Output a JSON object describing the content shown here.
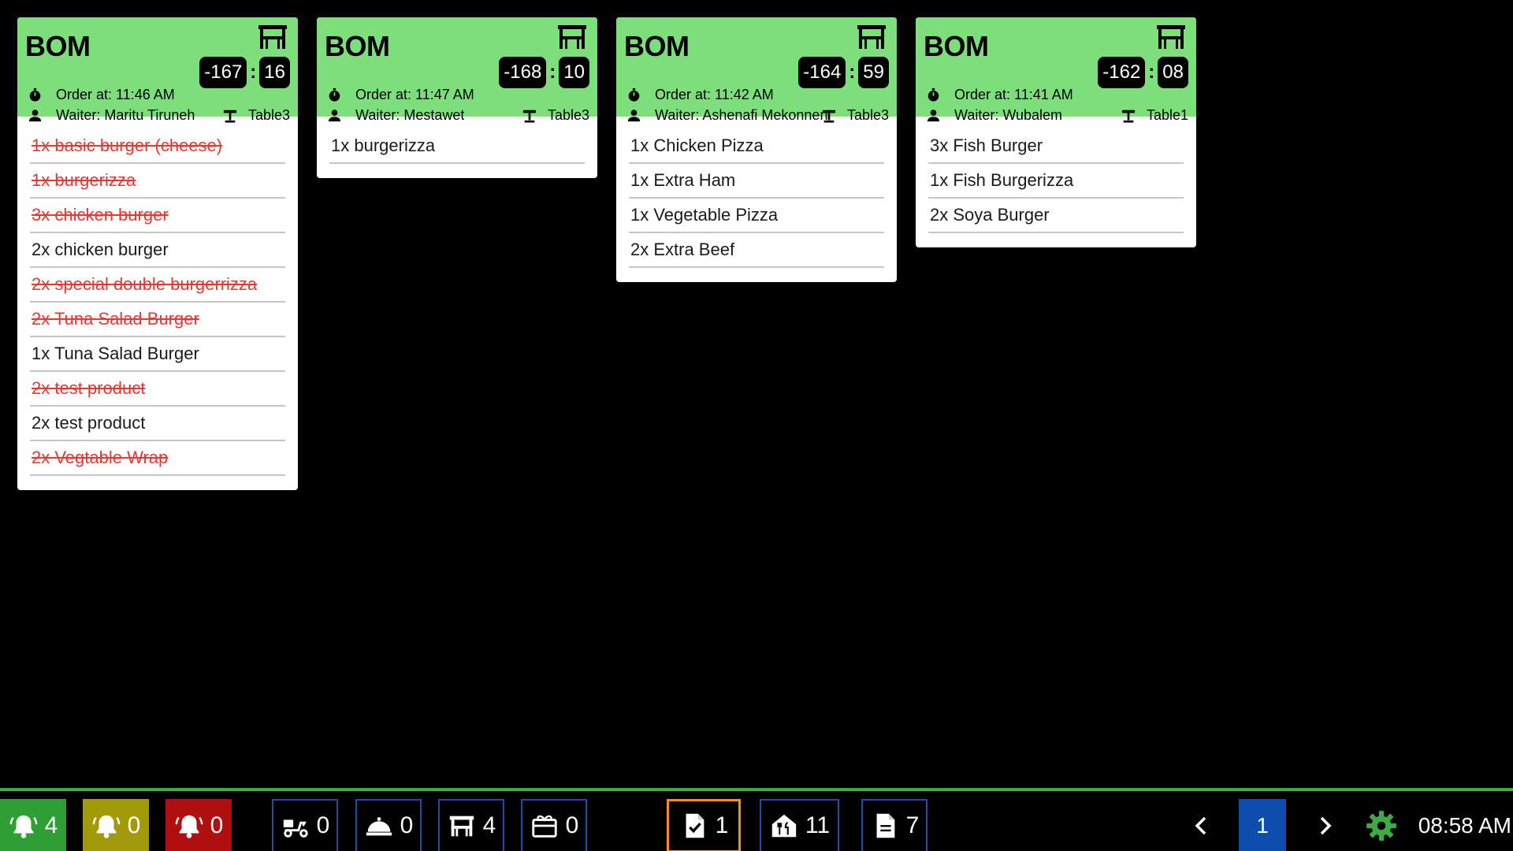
{
  "orders": [
    {
      "title": "BOM",
      "order_at": "Order at: 11:46 AM",
      "waiter": "Waiter: Maritu Tiruneh",
      "timer_min": "-167",
      "timer_sec": "16",
      "table": "Table3",
      "items": [
        {
          "text": "1x basic burger (cheese)",
          "done": true
        },
        {
          "text": "1x burgerizza",
          "done": true
        },
        {
          "text": "3x chicken burger",
          "done": true
        },
        {
          "text": "2x chicken burger",
          "done": false
        },
        {
          "text": "2x special double burgerrizza",
          "done": true
        },
        {
          "text": "2x Tuna Salad Burger",
          "done": true
        },
        {
          "text": "1x Tuna Salad Burger",
          "done": false
        },
        {
          "text": "2x test product",
          "done": true
        },
        {
          "text": "2x test product",
          "done": false
        },
        {
          "text": "2x Vegtable Wrap",
          "done": true
        }
      ]
    },
    {
      "title": "BOM",
      "order_at": "Order at: 11:47 AM",
      "waiter": "Waiter: Mestawet",
      "timer_min": "-168",
      "timer_sec": "10",
      "table": "Table3",
      "items": [
        {
          "text": "1x burgerizza",
          "done": false
        }
      ]
    },
    {
      "title": "BOM",
      "order_at": "Order at: 11:42 AM",
      "waiter": "Waiter: Ashenafi Mekonnen",
      "timer_min": "-164",
      "timer_sec": "59",
      "table": "Table3",
      "items": [
        {
          "text": "1x Chicken  Pizza",
          "done": false
        },
        {
          "text": "1x Extra Ham",
          "done": false
        },
        {
          "text": "1x Vegetable Pizza",
          "done": false
        },
        {
          "text": "2x Extra Beef",
          "done": false
        }
      ]
    },
    {
      "title": "BOM",
      "order_at": "Order at: 11:41 AM",
      "waiter": "Waiter: Wubalem",
      "timer_min": "-162",
      "timer_sec": "08",
      "table": "Table1",
      "items": [
        {
          "text": "3x Fish Burger",
          "done": false
        },
        {
          "text": "1x Fish Burgerizza",
          "done": false
        },
        {
          "text": "2x Soya Burger",
          "done": false
        }
      ]
    }
  ],
  "toolbar": {
    "bell_green_count": "4",
    "bell_yellow_count": "0",
    "bell_red_count": "0",
    "delivery_count": "0",
    "takeaway_count": "0",
    "dine_in_count": "4",
    "catering_count": "0",
    "completed_count": "1",
    "kitchen_count": "11",
    "documents_count": "7",
    "page_number": "1",
    "clock": "08:58 AM"
  },
  "colors": {
    "card_header": "#7ddf7c",
    "done_item": "#e53935",
    "bell_green": "#2e9e35",
    "bell_yellow": "#a39a0b",
    "bell_red": "#b00f10",
    "outline_blue": "#1e4ea3",
    "active_orange": "#f0921f",
    "page_blue": "#0d4dab",
    "gear_green": "#3daa44"
  },
  "icons": {
    "card_header": "dining-table-icon",
    "order_time": "stopwatch-icon",
    "waiter": "person-icon",
    "table": "round-table-icon",
    "bells": "bell-ring-icon",
    "delivery": "scooter-icon",
    "takeaway": "cloche-icon",
    "dine_in": "dining-table-icon",
    "catering": "gift-box-icon",
    "completed": "checked-document-icon",
    "kitchen": "kitchen-house-icon",
    "documents": "document-icon",
    "prev": "chevron-left-icon",
    "next": "chevron-right-icon",
    "settings": "gear-icon"
  }
}
